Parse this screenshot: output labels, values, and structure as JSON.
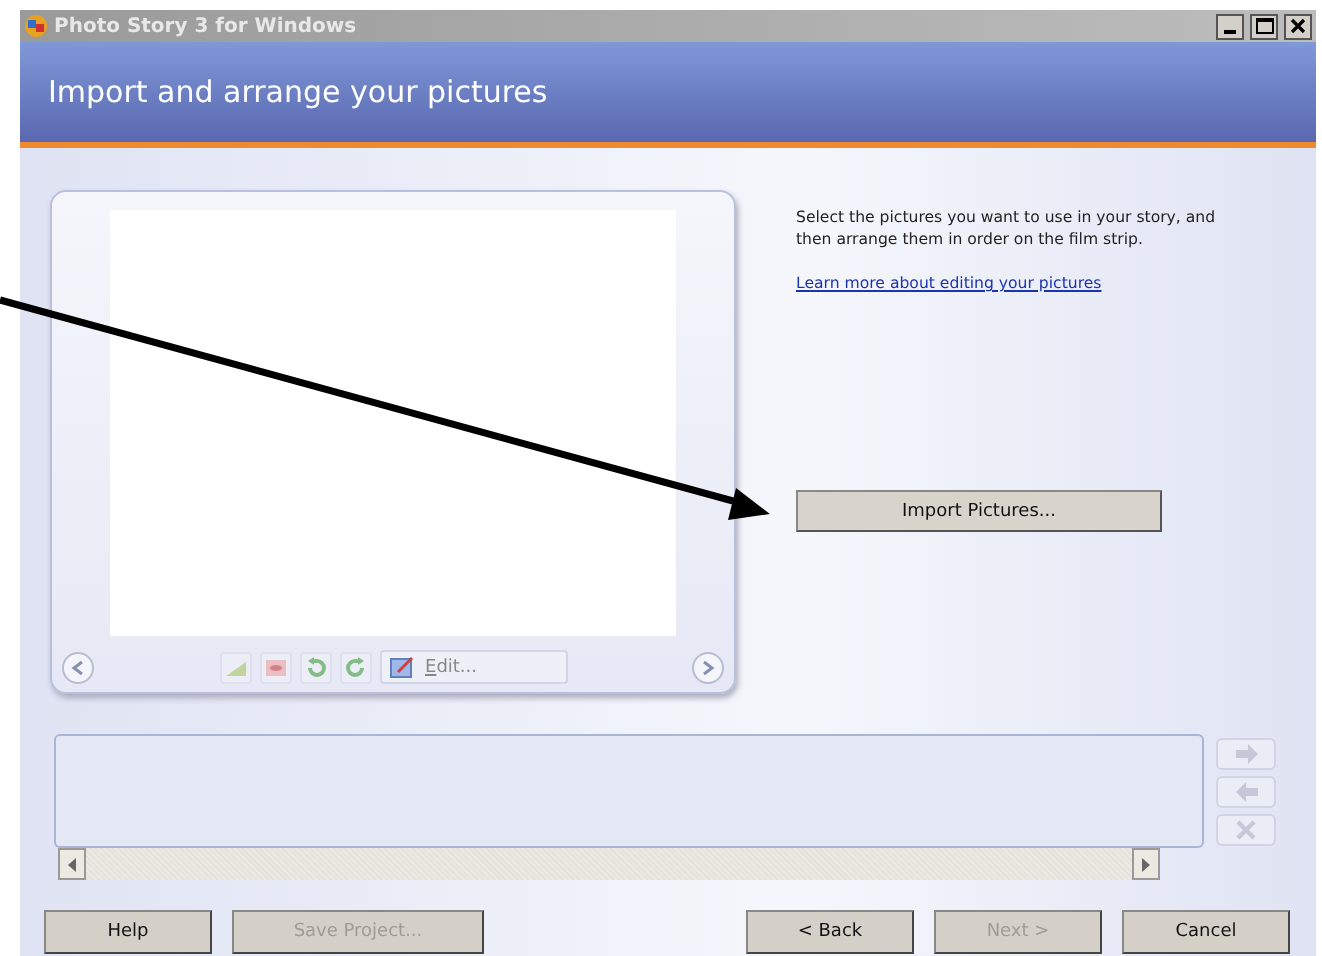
{
  "window": {
    "title": "Photo Story 3 for Windows"
  },
  "header": {
    "title": "Import and arrange your pictures"
  },
  "instructions": "Select the pictures you want to use in your story, and then arrange them in order on the film strip.",
  "help_link": "Learn more about editing your pictures",
  "import_button": {
    "label": "Import Pictures...",
    "disabled": false
  },
  "preview_toolbar": {
    "edit_button": {
      "label": "Edit...",
      "disabled": true
    }
  },
  "filmstrip_buttons": [
    {
      "kind": "right",
      "disabled": true
    },
    {
      "kind": "left",
      "disabled": true
    },
    {
      "kind": "remove",
      "disabled": true
    }
  ],
  "buttons": [
    {
      "label": "Help",
      "disabled": false
    },
    {
      "label": "Save Project...",
      "disabled": true
    },
    {
      "label": "< Back",
      "disabled": false
    },
    {
      "label": "Next >",
      "disabled": true
    },
    {
      "label": "Cancel",
      "disabled": false
    }
  ]
}
